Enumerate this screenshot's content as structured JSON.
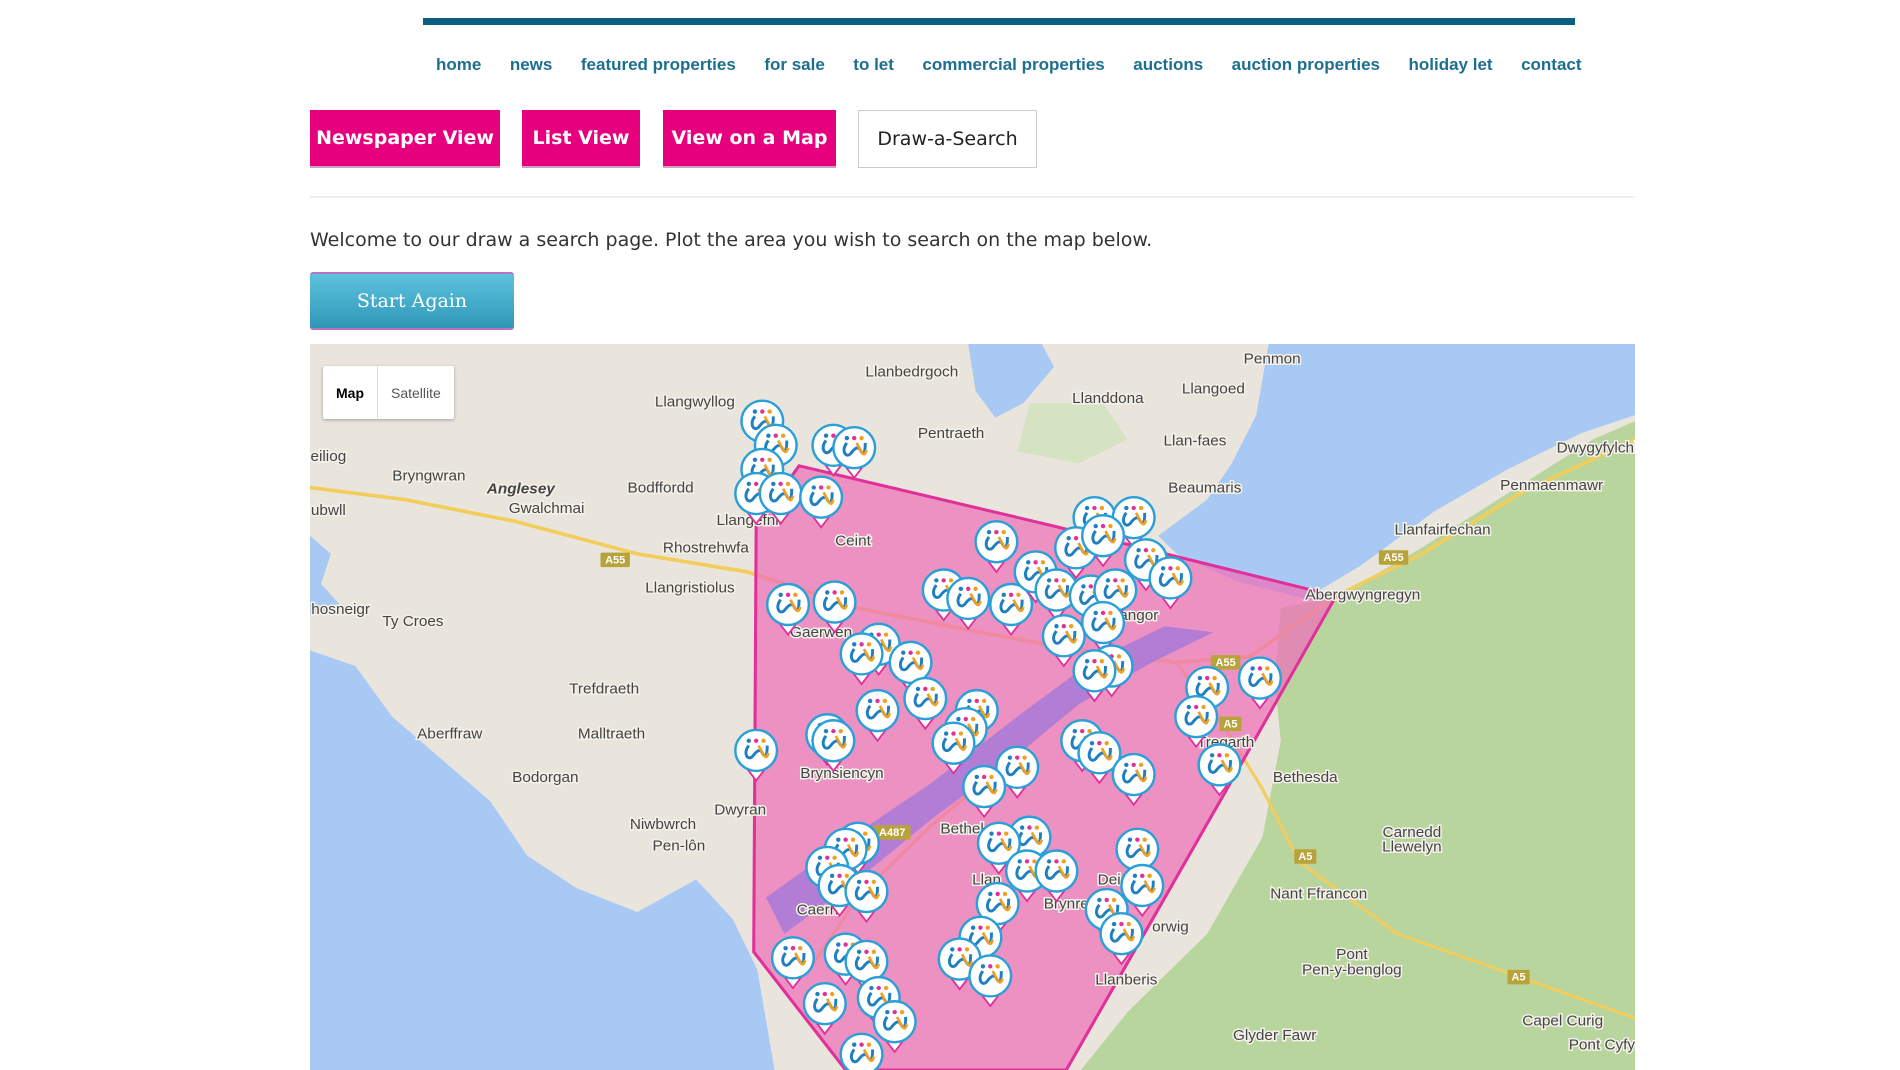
{
  "nav": [
    "home",
    "news",
    "featured properties",
    "for sale",
    "to let",
    "commercial properties",
    "auctions",
    "auction properties",
    "holiday let",
    "contact"
  ],
  "views": {
    "newspaper": "Newspaper View",
    "list": "List View",
    "map": "View on a Map",
    "draw": "Draw-a-Search"
  },
  "welcome": "Welcome to our draw a search page. Plot the area you wish to search on the map below.",
  "start_again": "Start Again",
  "map": {
    "type_control": {
      "map": "Map",
      "satellite": "Satellite",
      "selected": "Map"
    },
    "colors": {
      "land": "#e9e5dc",
      "water": "#a9c9f5",
      "green": "#b9d59e",
      "search_area": "#ee82c0",
      "search_border": "#e0309a",
      "marker_ring": "#2a9fd8"
    },
    "place_labels": [
      "Llanbedrgoch",
      "Penmon",
      "Llangwyllog",
      "Llanddona",
      "Llangoed",
      "Pentraeth",
      "Llan-faes",
      "eiliog",
      "Bryngwran",
      "Anglesey",
      "Bodffordd",
      "Beaumaris",
      "Dwygyfylchi",
      "Penmaenmawr",
      "ubwll",
      "Gwalchmai",
      "Llangefni",
      "Llanfairfechan",
      "Ceint",
      "Rhostrehwfa",
      "Llangristiolus",
      "Abergwyngregyn",
      "hosneigr",
      "Ty Croes",
      "Gaerwen",
      "Bangor",
      "Trefdraeth",
      "Aberffraw",
      "Malltraeth",
      "Tregarth",
      "Bethesda",
      "Bodorgan",
      "Brynsiencyn",
      "Dwyran",
      "Niwbwrch",
      "Pen-lôn",
      "Bethel",
      "Carnedd",
      "Llewelyn",
      "Nant Ffrancon",
      "Caern",
      "Brynre",
      "Dei",
      "Llan",
      "Pont",
      "Pen-y-benglog",
      "Llanberis",
      "orwig",
      "Glyder Fawr",
      "Capel Curig",
      "Pont Cyfy"
    ],
    "road_shields": [
      "A55",
      "A55",
      "A55",
      "A5",
      "A5",
      "A5",
      "A487"
    ]
  }
}
